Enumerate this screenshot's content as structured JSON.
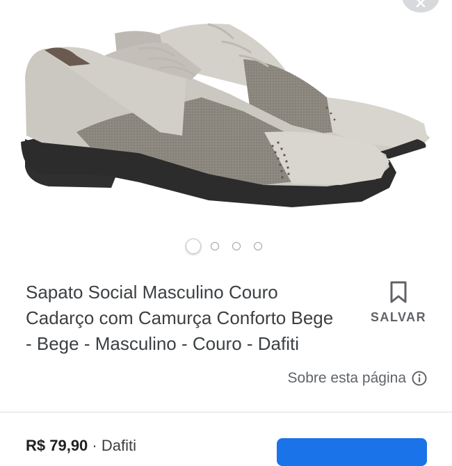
{
  "product": {
    "title_line1": "Sapato Social Masculino Couro",
    "title_line2": "Cadarço com Camurça Conforto Bege",
    "title_line3": "- Bege - Masculino - Couro - Dafiti",
    "image_icon": "leather-suede-oxford-shoes-image"
  },
  "carousel": {
    "total": 4,
    "active_index": 0
  },
  "save": {
    "label": "SALVAR",
    "icon": "bookmark-icon"
  },
  "about": {
    "label": "Sobre esta página",
    "icon": "info-icon"
  },
  "offer": {
    "price": "R$ 79,90",
    "separator": "·",
    "seller": "Dafiti"
  },
  "close": {
    "icon": "close-icon"
  },
  "colors": {
    "text": "#3c4043",
    "muted": "#5f6368",
    "accent": "#1a73e8",
    "divider": "#dadce0"
  }
}
